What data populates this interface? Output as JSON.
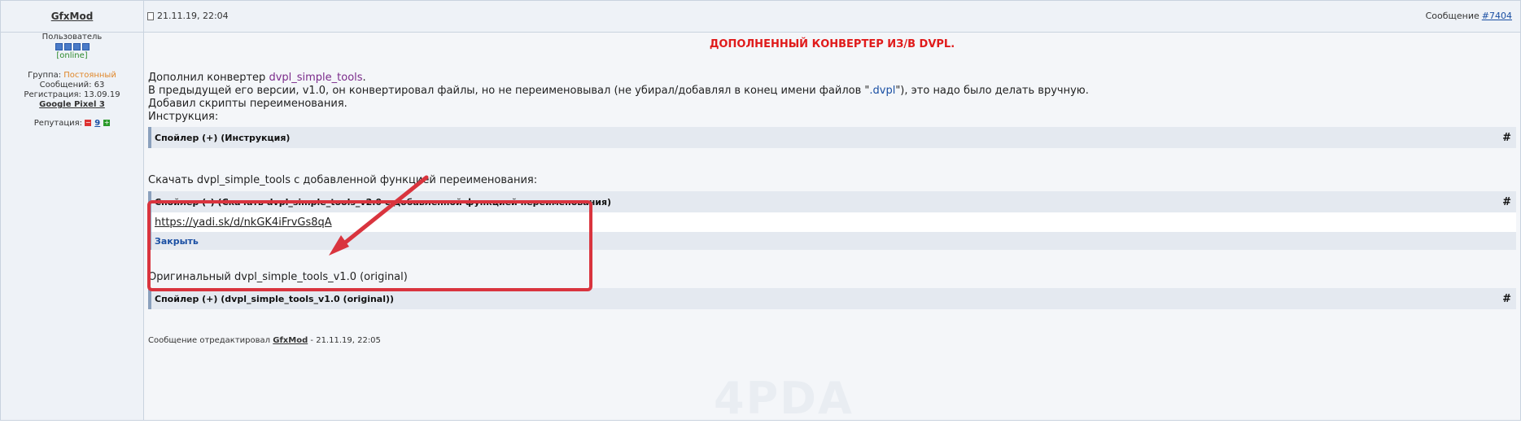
{
  "post": {
    "author": "GfxMod",
    "date": "21.11.19, 22:04",
    "message_label": "Сообщение",
    "message_number": "#7404"
  },
  "sidebar": {
    "role": "Пользователь",
    "status": "[online]",
    "group_label": "Группа:",
    "group_value": "Постоянный",
    "posts": "Сообщений: 63",
    "registered": "Регистрация: 13.09.19",
    "device": "Google Pixel 3",
    "reputation_label": "Репутация:",
    "reputation_value": "9",
    "rep_minus": "−",
    "rep_plus": "+"
  },
  "content": {
    "title": "ДОПОЛНЕННЫЙ КОНВЕРТЕР ИЗ/В DVPL.",
    "p1_prefix": "Дополнил конвертер ",
    "p1_link": "dvpl_simple_tools",
    "p1_suffix": ".",
    "p2_prefix": "В предыдущей его версии, v1.0, он конвертировал файлы, но не переименовывал (не убирал/добавлял в конец имени файлов \"",
    "p2_ext": ".dvpl",
    "p2_suffix": "\"), это надо было делать вручную.",
    "p3": "Добавил скрипты переименования.",
    "p4": "Инструкция:",
    "spoiler1_title": "Спойлер (+) (Инструкция)",
    "download_text": "Скачать dvpl_simple_tools с добавленной функцией переименования:",
    "spoiler2_title": "Спойлер (–) (Скачать dvpl_simple_tools_v2.0 с добавленной функцией переименования)",
    "spoiler2_link": "https://yadi.sk/d/nkGK4iFrvGs8qA",
    "spoiler2_close": "Закрыть",
    "original_text": "Оригинальный dvpl_simple_tools_v1.0 (original)",
    "spoiler3_title": "Спойлер (+) (dvpl_simple_tools_v1.0 (original))",
    "spoiler_hash": "#",
    "edit_prefix": "Сообщение отредактировал ",
    "edit_author": "GfxMod",
    "edit_suffix": " - 21.11.19, 22:05",
    "watermark": "4PDA"
  },
  "colors": {
    "title": "#e01b1b",
    "annotation": "#d9343e",
    "group": "#e0872a",
    "online": "#2e8b2e"
  }
}
